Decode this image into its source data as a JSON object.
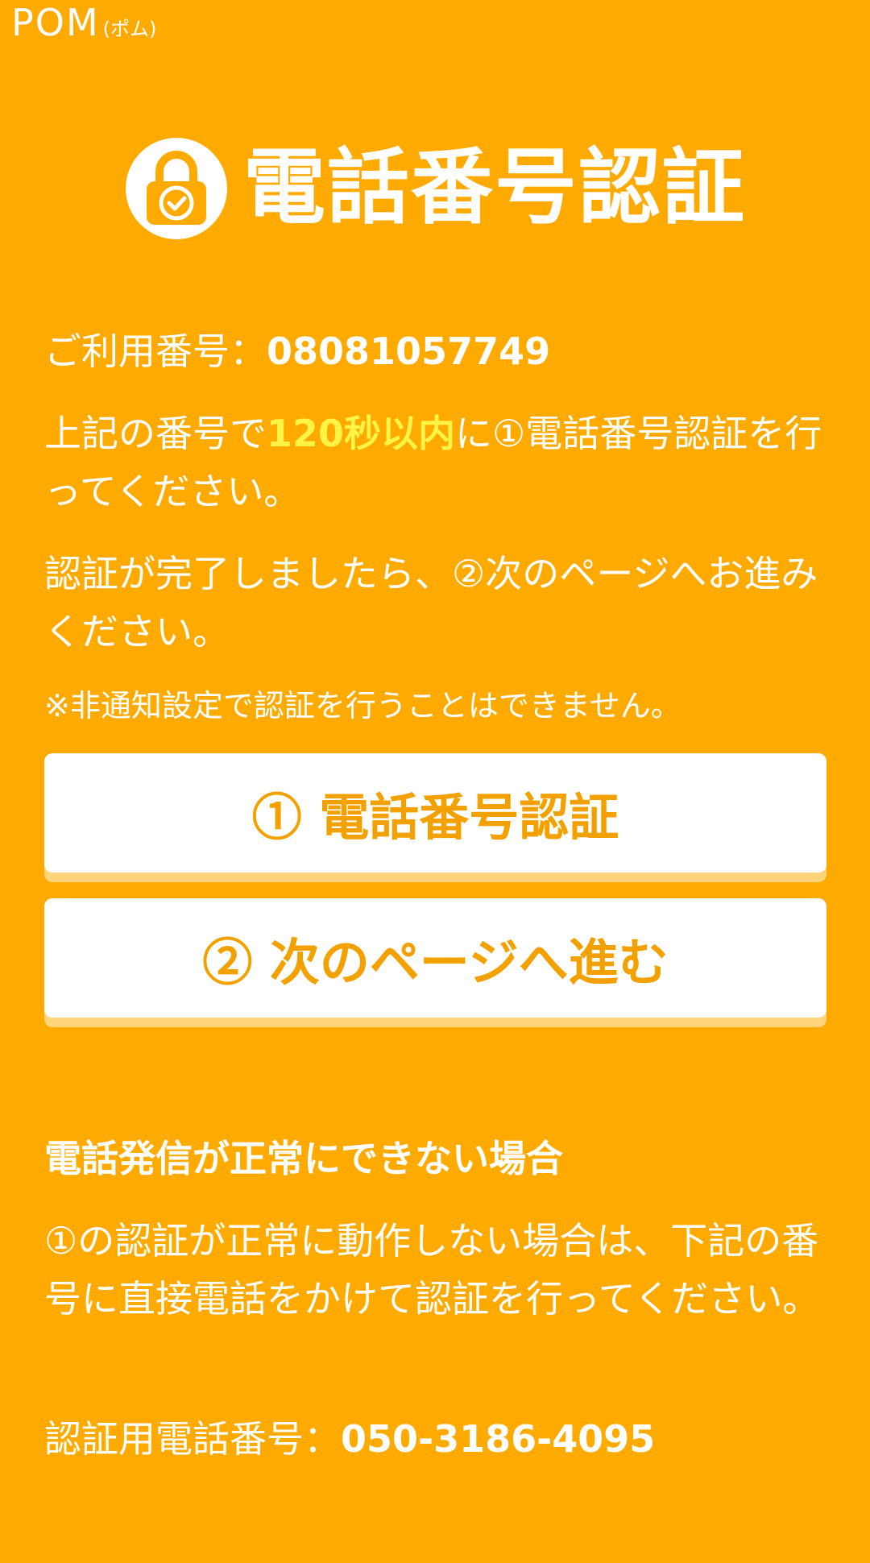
{
  "brand": {
    "name": "POM",
    "kana": "(ポム)"
  },
  "title": {
    "text": "電話番号認証",
    "icon": "lock-check-icon"
  },
  "user_number": {
    "label": "ご利用番号：",
    "value": "08081057749"
  },
  "instruction1": {
    "before": "上記の番号で",
    "highlight": "120秒以内",
    "after": "に①電話番号認証を行ってください。"
  },
  "instruction2": "認証が完了しましたら、②次のページへお進みください。",
  "note": "※非通知設定で認証を行うことはできません。",
  "buttons": {
    "verify_label": "① 電話番号認証",
    "next_label": "② 次のページへ進む"
  },
  "trouble": {
    "heading": "電話発信が正常にできない場合",
    "body": "①の認証が正常に動作しない場合は、下記の番号に直接電話をかけて認証を行ってください。",
    "auth_number_label": "認証用電話番号：",
    "auth_number_value": "050-3186-4095"
  },
  "colors": {
    "background": "#FFAA00",
    "text": "#FFFFFF",
    "highlight": "#FFF445",
    "button_bg": "#FFFFFF",
    "button_text": "#F2A100",
    "button_shadow": "#FFD47A"
  }
}
